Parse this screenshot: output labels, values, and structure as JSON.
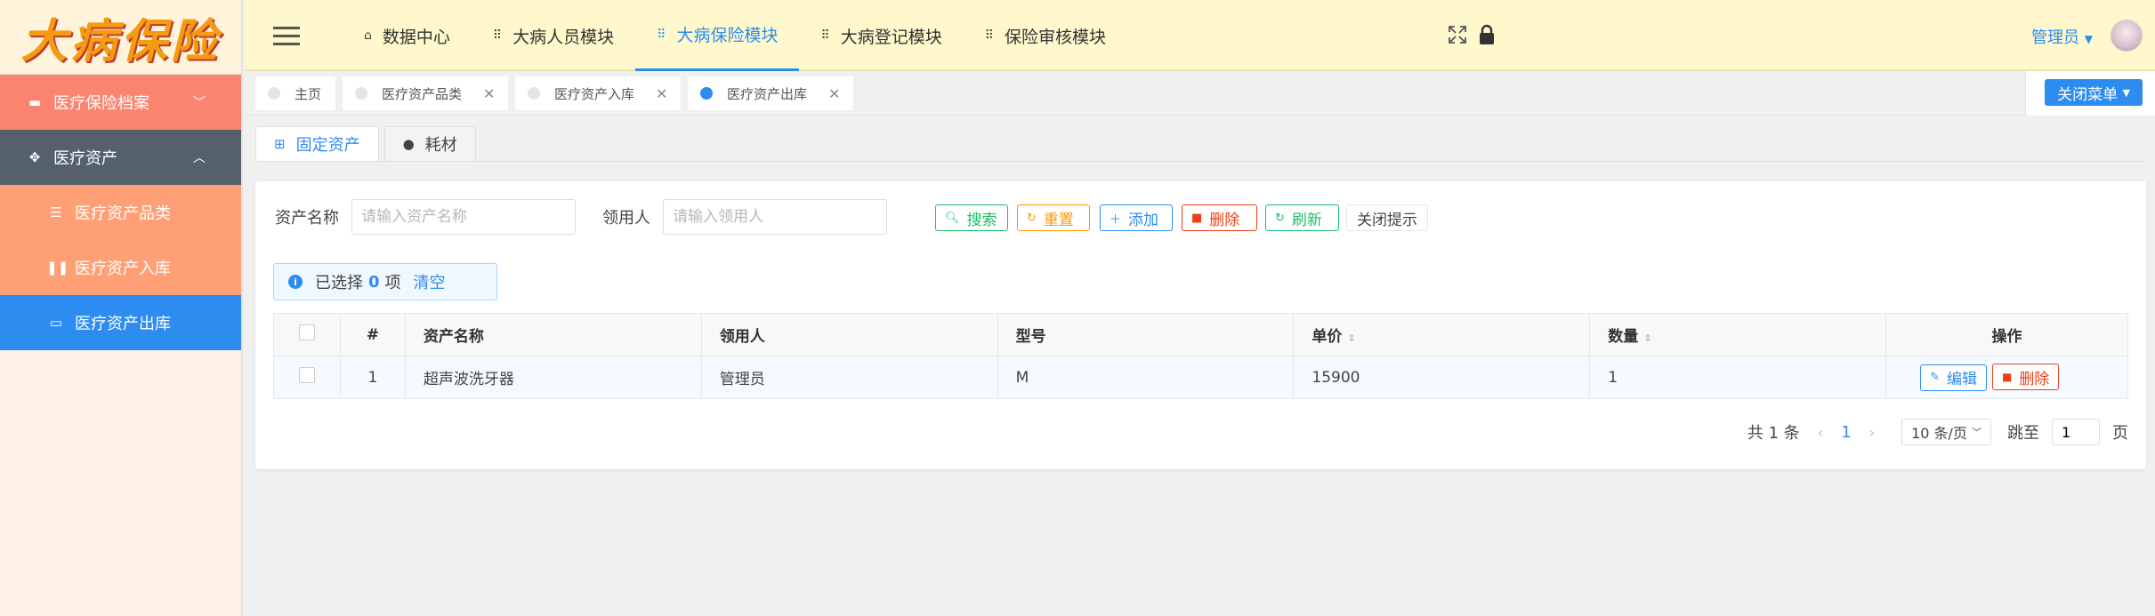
{
  "sidebar": {
    "logo": "大病保险",
    "menu": {
      "archive": "医疗保险档案",
      "assets": "医疗资产",
      "sub": [
        "医疗资产品类",
        "医疗资产入库",
        "医疗资产出库"
      ]
    }
  },
  "header": {
    "nav": [
      "数据中心",
      "大病人员模块",
      "大病保险模块",
      "大病登记模块",
      "保险审核模块"
    ],
    "user": "管理员"
  },
  "page_tabs": [
    "主页",
    "医疗资产品类",
    "医疗资产入库",
    "医疗资产出库"
  ],
  "close_menu": "关闭菜单",
  "sub_tabs": [
    "固定资产",
    "耗材"
  ],
  "search": {
    "name_label": "资产名称",
    "name_placeholder": "请输入资产名称",
    "user_label": "领用人",
    "user_placeholder": "请输入领用人"
  },
  "buttons": {
    "search": "搜索",
    "reset": "重置",
    "add": "添加",
    "delete": "删除",
    "refresh": "刷新",
    "close_tips": "关闭提示"
  },
  "selection": {
    "prefix": "已选择",
    "count": "0",
    "suffix": "项",
    "clear": "清空"
  },
  "table": {
    "headers": [
      "#",
      "资产名称",
      "领用人",
      "型号",
      "单价",
      "数量",
      "操作"
    ],
    "rows": [
      {
        "index": "1",
        "name": "超声波洗牙器",
        "user": "管理员",
        "model": "M",
        "price": "15900",
        "qty": "1"
      }
    ],
    "edit": "编辑",
    "delete": "删除"
  },
  "pagination": {
    "total": "共 1 条",
    "current": "1",
    "page_size": "10 条/页",
    "jump_label": "跳至",
    "jump_value": "1",
    "page_unit": "页"
  },
  "colors": {
    "accent": "#2d8cf0",
    "success": "#19be6b",
    "warning": "#ff9900",
    "danger": "#ed4014"
  }
}
